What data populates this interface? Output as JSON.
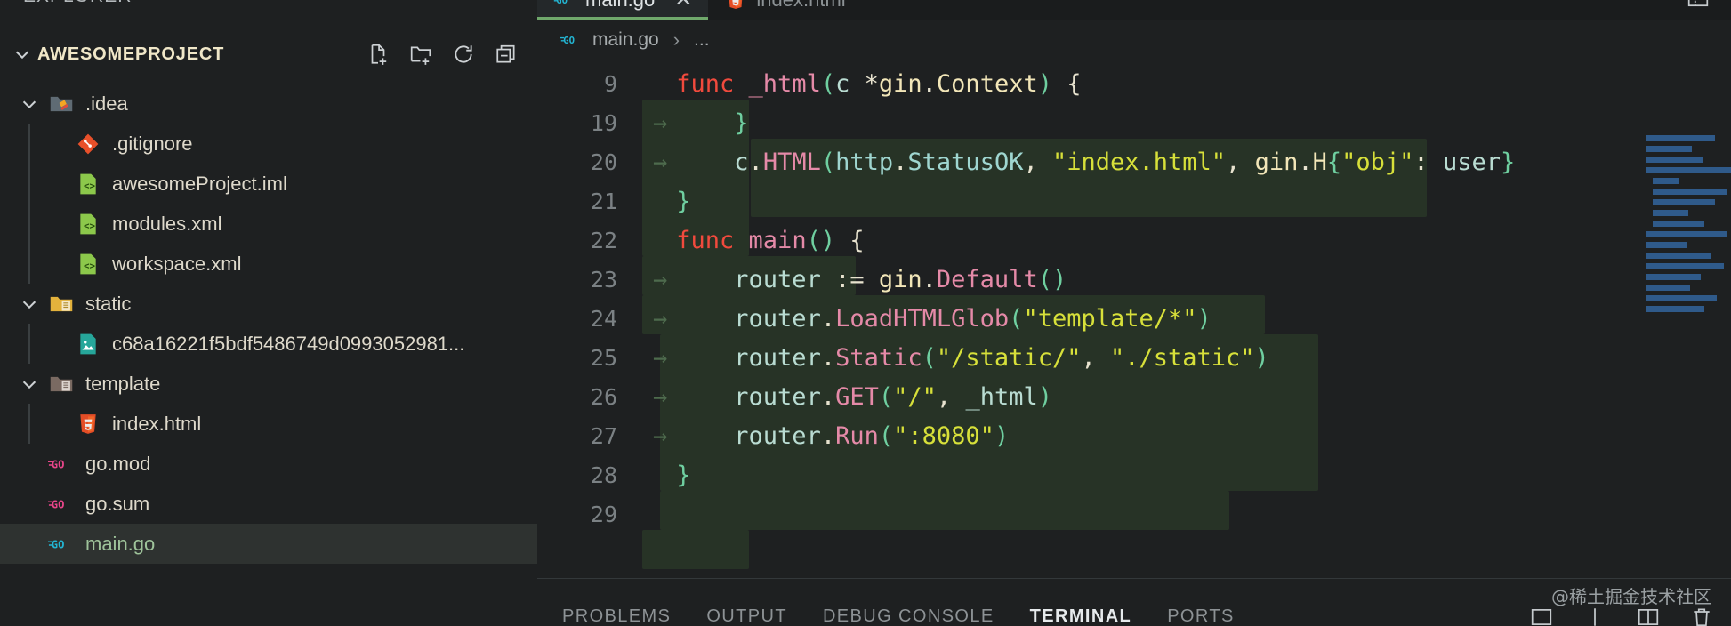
{
  "sidebar": {
    "header_label": "EXPLORER",
    "more_actions_icon": "ellipsis-icon",
    "project": {
      "name": "AWESOMEPROJECT",
      "expanded": true,
      "actions": [
        {
          "name": "new-file-icon",
          "label": "New File"
        },
        {
          "name": "new-folder-icon",
          "label": "New Folder"
        },
        {
          "name": "refresh-icon",
          "label": "Refresh Explorer"
        },
        {
          "name": "collapse-all-icon",
          "label": "Collapse Folders in Explorer"
        }
      ]
    },
    "items": [
      {
        "label": ".idea",
        "kind": "folder",
        "icon": "folder-idea-icon",
        "depth": 1,
        "expanded": true,
        "selected": false
      },
      {
        "label": ".gitignore",
        "kind": "file",
        "icon": "git-icon",
        "depth": 2,
        "selected": false
      },
      {
        "label": "awesomeProject.iml",
        "kind": "file",
        "icon": "xml-icon",
        "depth": 2,
        "selected": false
      },
      {
        "label": "modules.xml",
        "kind": "file",
        "icon": "xml-icon",
        "depth": 2,
        "selected": false
      },
      {
        "label": "workspace.xml",
        "kind": "file",
        "icon": "xml-icon",
        "depth": 2,
        "selected": false
      },
      {
        "label": "static",
        "kind": "folder",
        "icon": "folder-static-icon",
        "depth": 1,
        "expanded": true,
        "selected": false
      },
      {
        "label": "c68a16221f5bdf5486749d0993052981...",
        "kind": "file",
        "icon": "image-icon",
        "depth": 2,
        "selected": false
      },
      {
        "label": "template",
        "kind": "folder",
        "icon": "folder-template-icon",
        "depth": 1,
        "expanded": true,
        "selected": false
      },
      {
        "label": "index.html",
        "kind": "file",
        "icon": "html5-icon",
        "depth": 2,
        "selected": false
      },
      {
        "label": "go.mod",
        "kind": "file",
        "icon": "go-icon",
        "depth": 1,
        "selected": false
      },
      {
        "label": "go.sum",
        "kind": "file",
        "icon": "go-icon",
        "depth": 1,
        "selected": false
      },
      {
        "label": "main.go",
        "kind": "file",
        "icon": "go-icon-active",
        "depth": 1,
        "selected": true
      }
    ]
  },
  "editor": {
    "tabs": [
      {
        "label": "main.go",
        "icon": "go-icon",
        "active": true,
        "close_icon": "close-icon"
      },
      {
        "label": "index.html",
        "icon": "html5-icon",
        "active": false
      }
    ],
    "breadcrumb": {
      "file": "main.go",
      "icon": "go-icon",
      "separator": "›",
      "more": "..."
    },
    "layout_icons": [
      {
        "name": "toggle-panel-icon"
      }
    ],
    "lines": [
      {
        "num": "9",
        "segments": [
          {
            "t": "func ",
            "c": "k"
          },
          {
            "t": "_html",
            "c": "fn"
          },
          {
            "t": "(",
            "c": "pu"
          },
          {
            "t": "c ",
            "c": "va"
          },
          {
            "t": "*",
            "c": "pa"
          },
          {
            "t": "gin",
            "c": "ty"
          },
          {
            "t": ".",
            "c": "pa"
          },
          {
            "t": "Context",
            "c": "ty"
          },
          {
            "t": ")",
            "c": "pu"
          },
          {
            "t": " {",
            "c": "pa"
          }
        ]
      },
      {
        "num": "19",
        "indent_arrow": true,
        "segments": [
          {
            "t": "\t}",
            "c": "pu"
          }
        ]
      },
      {
        "num": "20",
        "indent_arrow": true,
        "segments": [
          {
            "t": "\tc",
            "c": "va"
          },
          {
            "t": ".",
            "c": "pa"
          },
          {
            "t": "HTML",
            "c": "fn"
          },
          {
            "t": "(",
            "c": "pu"
          },
          {
            "t": "http",
            "c": "cy"
          },
          {
            "t": ".",
            "c": "pa"
          },
          {
            "t": "StatusOK",
            "c": "cy"
          },
          {
            "t": ", ",
            "c": "pa"
          },
          {
            "t": "\"index.html\"",
            "c": "st"
          },
          {
            "t": ", ",
            "c": "pa"
          },
          {
            "t": "gin",
            "c": "ty"
          },
          {
            "t": ".",
            "c": "pa"
          },
          {
            "t": "H",
            "c": "ty"
          },
          {
            "t": "{",
            "c": "pu"
          },
          {
            "t": "\"obj\"",
            "c": "st"
          },
          {
            "t": ": ",
            "c": "pa"
          },
          {
            "t": "user",
            "c": "va"
          },
          {
            "t": "}",
            "c": "pu"
          }
        ]
      },
      {
        "num": "21",
        "segments": [
          {
            "t": "}",
            "c": "pu"
          }
        ]
      },
      {
        "num": "22",
        "segments": [
          {
            "t": "func ",
            "c": "k"
          },
          {
            "t": "main",
            "c": "fn"
          },
          {
            "t": "()",
            "c": "pu"
          },
          {
            "t": " {",
            "c": "pa"
          }
        ]
      },
      {
        "num": "23",
        "indent_arrow": true,
        "segments": [
          {
            "t": "\trouter ",
            "c": "va"
          },
          {
            "t": ":= ",
            "c": "pa"
          },
          {
            "t": "gin",
            "c": "ty"
          },
          {
            "t": ".",
            "c": "pa"
          },
          {
            "t": "Default",
            "c": "fn"
          },
          {
            "t": "()",
            "c": "pu"
          }
        ]
      },
      {
        "num": "24",
        "indent_arrow": true,
        "segments": [
          {
            "t": "\trouter",
            "c": "va"
          },
          {
            "t": ".",
            "c": "pa"
          },
          {
            "t": "LoadHTMLGlob",
            "c": "fn"
          },
          {
            "t": "(",
            "c": "pu"
          },
          {
            "t": "\"template/*\"",
            "c": "st"
          },
          {
            "t": ")",
            "c": "pu"
          }
        ]
      },
      {
        "num": "25",
        "indent_arrow": true,
        "segments": [
          {
            "t": "\trouter",
            "c": "va"
          },
          {
            "t": ".",
            "c": "pa"
          },
          {
            "t": "Static",
            "c": "fn"
          },
          {
            "t": "(",
            "c": "pu"
          },
          {
            "t": "\"/static/\"",
            "c": "st"
          },
          {
            "t": ", ",
            "c": "pa"
          },
          {
            "t": "\"./static\"",
            "c": "st"
          },
          {
            "t": ")",
            "c": "pu"
          }
        ]
      },
      {
        "num": "26",
        "indent_arrow": true,
        "segments": [
          {
            "t": "\trouter",
            "c": "va"
          },
          {
            "t": ".",
            "c": "pa"
          },
          {
            "t": "GET",
            "c": "fn"
          },
          {
            "t": "(",
            "c": "pu"
          },
          {
            "t": "\"/\"",
            "c": "st"
          },
          {
            "t": ", ",
            "c": "pa"
          },
          {
            "t": "_html",
            "c": "va"
          },
          {
            "t": ")",
            "c": "pu"
          }
        ]
      },
      {
        "num": "27",
        "indent_arrow": true,
        "segments": [
          {
            "t": "\trouter",
            "c": "va"
          },
          {
            "t": ".",
            "c": "pa"
          },
          {
            "t": "Run",
            "c": "fn"
          },
          {
            "t": "(",
            "c": "pu"
          },
          {
            "t": "\":8080\"",
            "c": "st"
          },
          {
            "t": ")",
            "c": "pu"
          }
        ]
      },
      {
        "num": "28",
        "segments": [
          {
            "t": "}",
            "c": "pu"
          }
        ]
      },
      {
        "num": "29",
        "segments": []
      }
    ]
  },
  "panel": {
    "tabs": [
      {
        "label": "PROBLEMS",
        "active": false
      },
      {
        "label": "OUTPUT",
        "active": false
      },
      {
        "label": "DEBUG CONSOLE",
        "active": false
      },
      {
        "label": "TERMINAL",
        "active": true
      },
      {
        "label": "PORTS",
        "active": false
      }
    ],
    "actions": [
      {
        "name": "new-terminal-icon"
      },
      {
        "name": "split-terminal-icon"
      },
      {
        "name": "kill-terminal-icon"
      }
    ]
  },
  "watermark": {
    "text": "@稀土掘金技术社区"
  },
  "colors": {
    "background": "#1e2021",
    "sidebar_bg": "#1e2021",
    "selection_green": "#2b3a2c",
    "tab_active_underline": "#6fa86b",
    "accent_string": "#d7e03a",
    "accent_keyword": "#f14a3d",
    "accent_function": "#e58aa8",
    "minimap_line": "#2f5a8a"
  }
}
